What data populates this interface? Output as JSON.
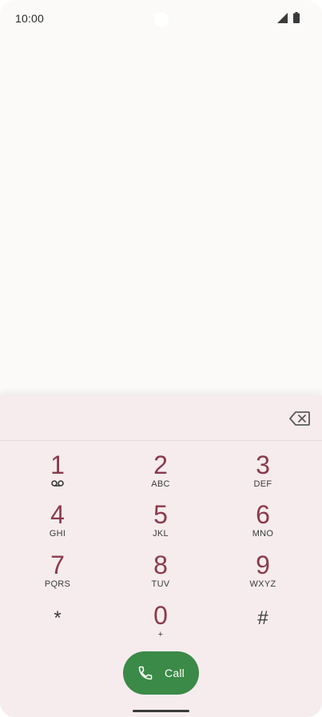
{
  "status_bar": {
    "time": "10:00",
    "icons": [
      "camera-cutout",
      "signal-icon",
      "battery-icon"
    ]
  },
  "dialpad": {
    "backspace_icon": "backspace-icon",
    "keys": [
      {
        "digit": "1",
        "letters": "",
        "icon": "voicemail-icon"
      },
      {
        "digit": "2",
        "letters": "ABC"
      },
      {
        "digit": "3",
        "letters": "DEF"
      },
      {
        "digit": "4",
        "letters": "GHI"
      },
      {
        "digit": "5",
        "letters": "JKL"
      },
      {
        "digit": "6",
        "letters": "MNO"
      },
      {
        "digit": "7",
        "letters": "PQRS"
      },
      {
        "digit": "8",
        "letters": "TUV"
      },
      {
        "digit": "9",
        "letters": "WXYZ"
      },
      {
        "digit": "*",
        "letters": ""
      },
      {
        "digit": "0",
        "letters": "+"
      },
      {
        "digit": "#",
        "letters": ""
      }
    ],
    "call_button": {
      "label": "Call",
      "icon": "phone-icon"
    }
  },
  "colors": {
    "digit": "#8a3a4c",
    "call_button": "#3b8a47",
    "sheet_background": "#f6ecee"
  }
}
